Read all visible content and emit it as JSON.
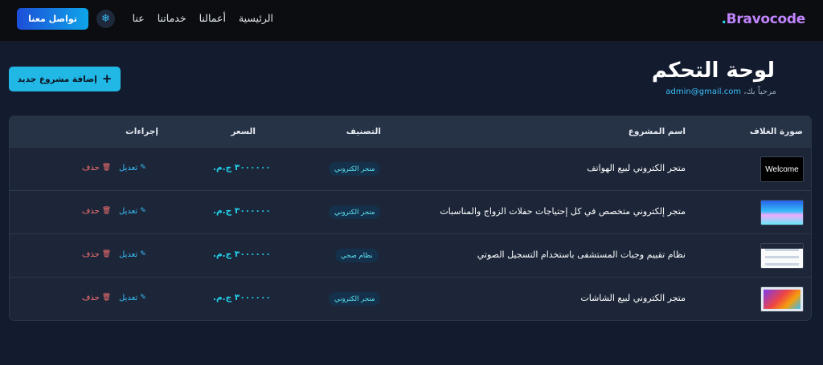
{
  "nav": {
    "brand": "Bravocode",
    "brand_dot": ".",
    "links": [
      "الرئيسية",
      "أعمالنا",
      "خدماتنا",
      "عنا"
    ],
    "theme_icon": "❄",
    "contact_label": "تواصل معنا"
  },
  "header": {
    "title": "لوحة التحكم",
    "welcome_prefix": "مرحباً بك،",
    "email": "admin@gmail.com",
    "add_button_label": "إضافة مشروع جديد"
  },
  "table": {
    "headers": {
      "cover": "صورة الغلاف",
      "name": "اسم المشروع",
      "category": "التصنيف",
      "price": "السعر",
      "actions": "إجراءات"
    },
    "edit_label": "تعديل",
    "delete_label": "حذف",
    "rows": [
      {
        "thumb_text": "Welcome",
        "name": "متجر الكتروني لبيع الهواتف",
        "category": "متجر الكتروني",
        "price": "٣٠٠٠٠٠٠ ج.م."
      },
      {
        "thumb_text": "",
        "name": "متجر إلكتروني متخصص في كل إحتياجات حفلات الزواج والمناسبات",
        "category": "متجر الكتروني",
        "price": "٣٠٠٠٠٠٠ ج.م."
      },
      {
        "thumb_text": "",
        "name": "نظام تقييم وجبات المستشفى باستخدام التسجيل الصوتي",
        "category": "نظام صحي",
        "price": "٣٠٠٠٠٠٠ ج.م."
      },
      {
        "thumb_text": "",
        "name": "متجر الكتروني لبيع الشاشات",
        "category": "متجر الكتروني",
        "price": "٣٠٠٠٠٠٠ ج.م."
      }
    ]
  }
}
